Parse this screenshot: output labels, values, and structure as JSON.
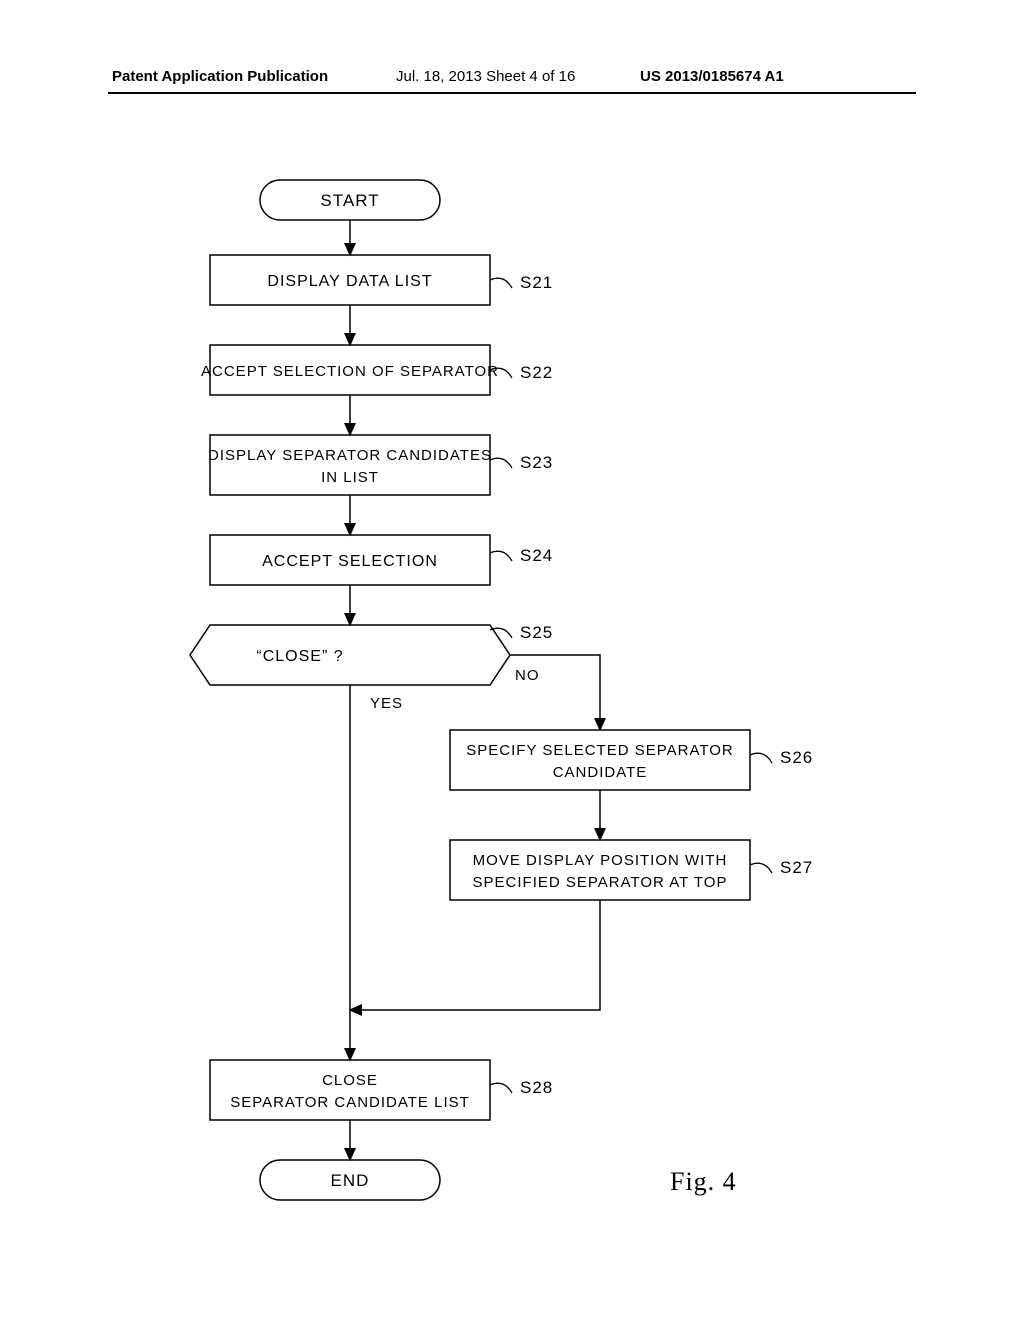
{
  "header": {
    "left": "Patent Application Publication",
    "mid": "Jul. 18, 2013   Sheet 4 of 16",
    "right": "US 2013/0185674 A1"
  },
  "nodes": {
    "start": "START",
    "s21": "DISPLAY DATA LIST",
    "s22": "ACCEPT SELECTION OF SEPARATOR",
    "s23_l1": "DISPLAY SEPARATOR CANDIDATES",
    "s23_l2": "IN LIST",
    "s24": "ACCEPT SELECTION",
    "s25": "“CLOSE” ?",
    "s26_l1": "SPECIFY SELECTED SEPARATOR",
    "s26_l2": "CANDIDATE",
    "s27_l1": "MOVE DISPLAY POSITION WITH",
    "s27_l2": "SPECIFIED SEPARATOR AT TOP",
    "s28_l1": "CLOSE",
    "s28_l2": "SEPARATOR CANDIDATE LIST",
    "end": "END"
  },
  "labels": {
    "s21": "S21",
    "s22": "S22",
    "s23": "S23",
    "s24": "S24",
    "s25": "S25",
    "s26": "S26",
    "s27": "S27",
    "s28": "S28",
    "yes": "YES",
    "no": "NO"
  },
  "figure": "Fig.  4"
}
